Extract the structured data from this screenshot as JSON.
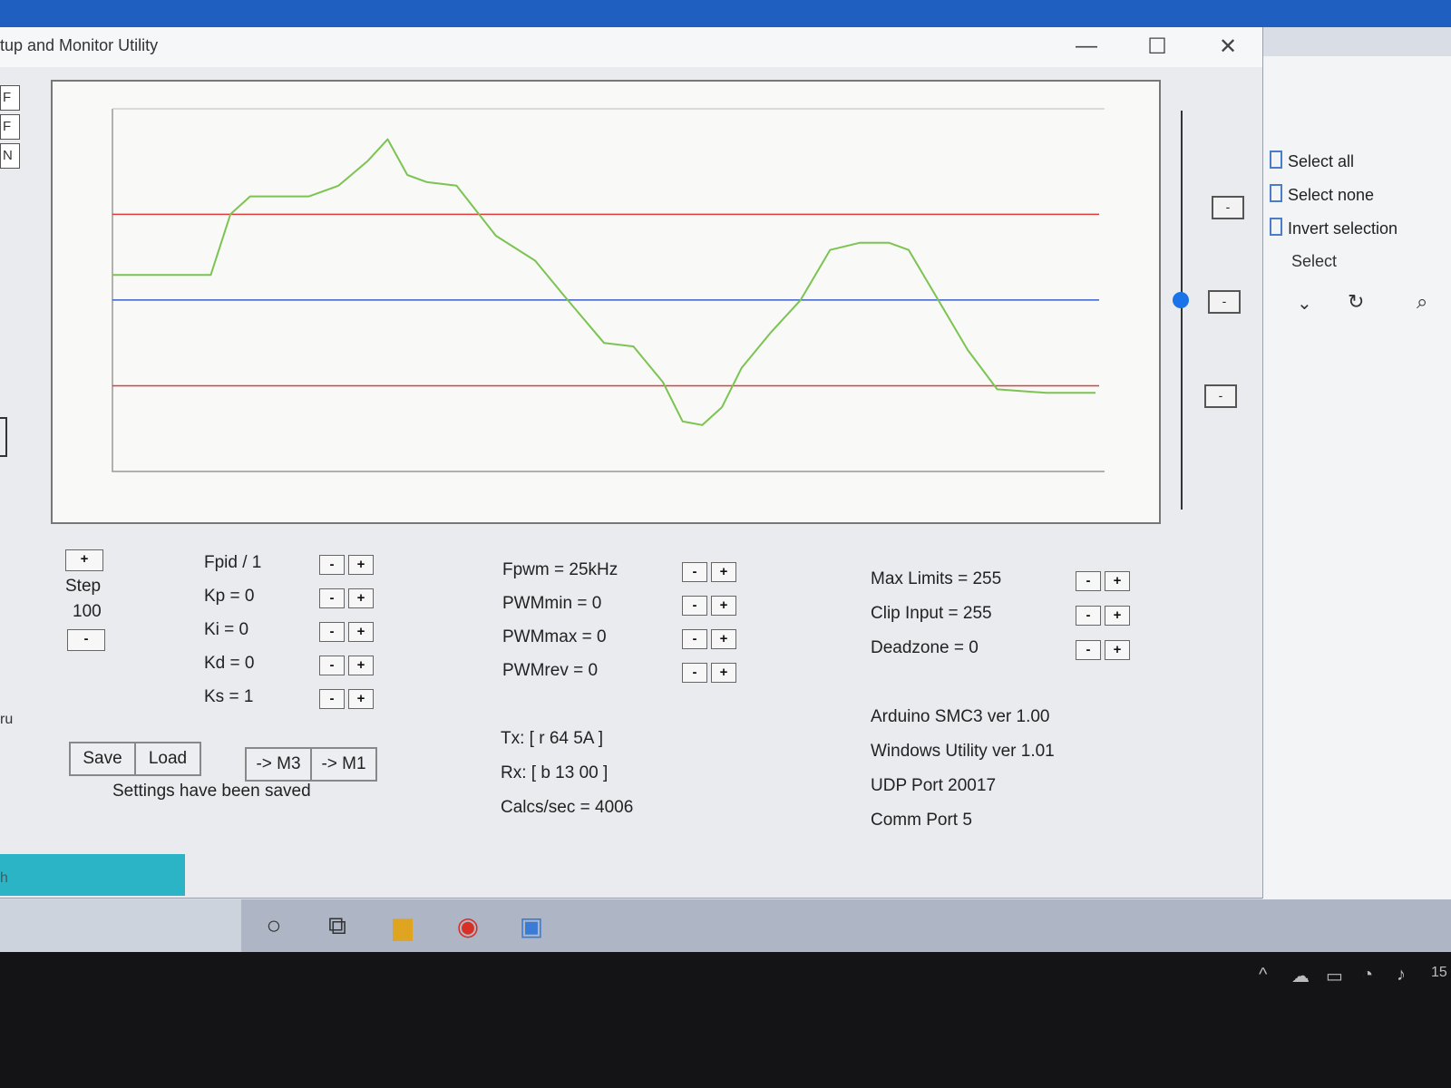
{
  "window": {
    "title": "tup and Monitor Utility",
    "minimize_glyph": "—",
    "maximize_glyph": "☐",
    "close_glyph": "✕"
  },
  "left_strip": {
    "labels": [
      "F",
      "F",
      "N"
    ],
    "ru_text": "ru"
  },
  "chart_data": {
    "type": "line",
    "title": "",
    "xlabel": "",
    "ylabel": "",
    "grid": false,
    "reference_lines": [
      {
        "color": "#e03c3c",
        "level": 0.72
      },
      {
        "color": "#3a5fcf",
        "level": 0.48
      },
      {
        "color": "#e03c3c",
        "level": 0.24
      }
    ],
    "series": [
      {
        "color": "#7cc452",
        "x": [
          0,
          0.05,
          0.1,
          0.12,
          0.14,
          0.2,
          0.23,
          0.26,
          0.28,
          0.3,
          0.32,
          0.35,
          0.37,
          0.39,
          0.43,
          0.46,
          0.5,
          0.53,
          0.56,
          0.58,
          0.6,
          0.62,
          0.64,
          0.67,
          0.7,
          0.73,
          0.76,
          0.79,
          0.81,
          0.84,
          0.87,
          0.9,
          0.95,
          1.0
        ],
        "y": [
          0.55,
          0.55,
          0.55,
          0.72,
          0.77,
          0.77,
          0.8,
          0.87,
          0.93,
          0.83,
          0.81,
          0.8,
          0.73,
          0.66,
          0.59,
          0.49,
          0.36,
          0.35,
          0.25,
          0.14,
          0.13,
          0.18,
          0.29,
          0.39,
          0.48,
          0.62,
          0.64,
          0.64,
          0.62,
          0.48,
          0.34,
          0.23,
          0.22,
          0.22
        ]
      }
    ]
  },
  "side_buttons": [
    "-",
    "-",
    "-"
  ],
  "step": {
    "plus": "+",
    "label": "Step",
    "value": "100",
    "minus": "-"
  },
  "pid": {
    "rows": [
      "Fpid / 1",
      "Kp = 0",
      "Ki = 0",
      "Kd = 0",
      "Ks = 1"
    ]
  },
  "pwm": {
    "rows": [
      "Fpwm = 25kHz",
      "PWMmin = 0",
      "PWMmax = 0",
      "PWMrev = 0"
    ]
  },
  "limits": {
    "rows": [
      "Max Limits = 255",
      "Clip Input = 255",
      "Deadzone = 0"
    ]
  },
  "stepper": {
    "minus": "-",
    "plus": "+"
  },
  "buttons": {
    "save": "Save",
    "load": "Load",
    "to_m3": "-> M3",
    "to_m1": "-> M1"
  },
  "status": "Settings have been saved",
  "comm": {
    "tx": "Tx: [ r 64 5A ]",
    "rx": "Rx: [ b 13 00 ]",
    "calcs": "Calcs/sec = 4006"
  },
  "info": [
    "Arduino SMC3 ver 1.00",
    "Windows Utility ver 1.01",
    "UDP Port 20017",
    "Comm Port 5"
  ],
  "bg_window": {
    "select_all": "Select all",
    "select_none": "Select none",
    "invert_selection": "Invert selection",
    "select_group": "Select"
  },
  "status_h": "h",
  "tray_clock": "15"
}
